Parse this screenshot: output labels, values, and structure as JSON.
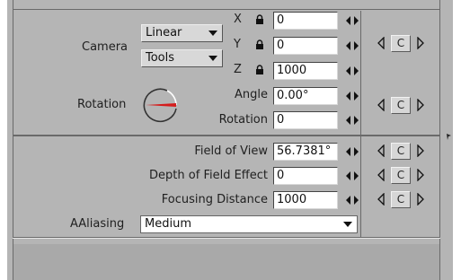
{
  "camera": {
    "label": "Camera",
    "interp_value": "Linear",
    "target_value": "Tools",
    "x_label": "X",
    "x_value": "0",
    "y_label": "Y",
    "y_value": "0",
    "z_label": "Z",
    "z_value": "1000"
  },
  "rotation": {
    "label": "Rotation",
    "angle_label": "Angle",
    "angle_value": "0.00°",
    "rotation_label": "Rotation",
    "rotation_value": "0"
  },
  "lens": {
    "fov_label": "Field of View",
    "fov_value": "56.7381°",
    "dof_label": "Depth of Field Effect",
    "dof_value": "0",
    "focus_label": "Focusing Distance",
    "focus_value": "1000"
  },
  "aaliasing": {
    "label": "AAliasing",
    "value": "Medium"
  },
  "reset_button_label": "C",
  "colors": {
    "panel": "#b5b5b5",
    "dial_indicator": "#d41d1d"
  },
  "icons": [
    "lock-icon",
    "spin-arrows-icon",
    "triangle-left-icon",
    "triangle-right-icon",
    "rotation-dial-icon"
  ]
}
